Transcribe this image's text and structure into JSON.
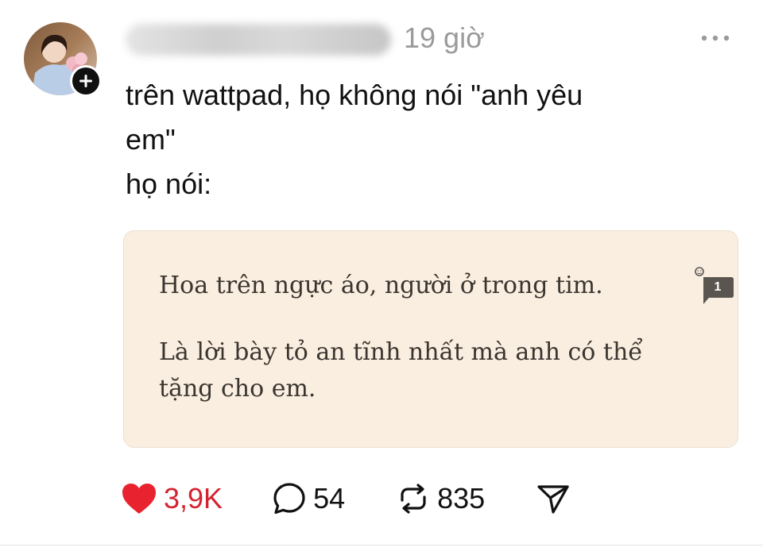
{
  "post": {
    "time": "19 giờ",
    "text": "trên wattpad, họ không nói \"anh yêu\nem\"\nhọ nói:",
    "quote": {
      "line1": "Hoa trên ngực áo, người ở trong tim.",
      "line2": "Là lời bày tỏ an tĩnh nhất mà anh có thể tặng cho em.",
      "comment_count": "1",
      "background": "#faeee0"
    },
    "actions": {
      "likes": "3,9K",
      "comments": "54",
      "reposts": "835"
    },
    "colors": {
      "like_red": "#e8232f",
      "meta_gray": "#9a9a9a"
    },
    "icons": {
      "follow": "plus-icon",
      "more": "more-dots-icon",
      "like": "heart-icon",
      "comment": "comment-bubble-icon",
      "repost": "repost-icon",
      "share": "send-icon"
    }
  }
}
